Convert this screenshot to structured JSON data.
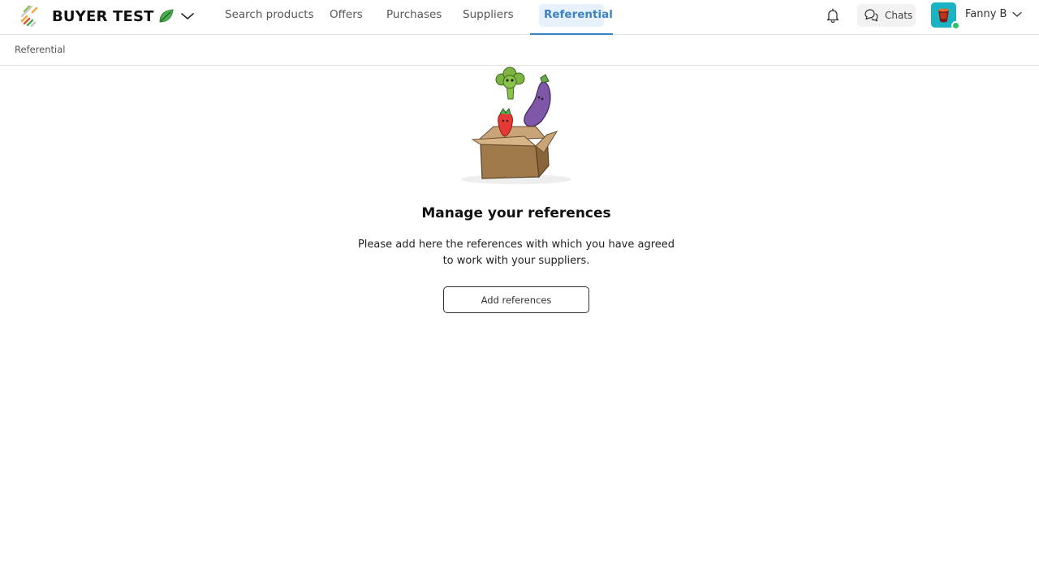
{
  "brand": {
    "name": "BUYER TEST"
  },
  "nav": {
    "items": [
      {
        "label": "Search products"
      },
      {
        "label": "Offers"
      },
      {
        "label": "Purchases"
      },
      {
        "label": "Suppliers"
      },
      {
        "label": "Referential",
        "active": true
      }
    ]
  },
  "header": {
    "chats_label": "Chats",
    "user_name": "Fanny B",
    "user_status": "online"
  },
  "breadcrumb": {
    "label": "Referential"
  },
  "empty_state": {
    "title": "Manage your references",
    "text": "Please add here the references with which you have agreed to work with your suppliers.",
    "button_label": "Add references"
  },
  "colors": {
    "accent": "#3b82c4",
    "accent_bg": "#e7f1fb",
    "online": "#2fc26b",
    "avatar_bg": "#19b3c4"
  },
  "icons": [
    "brand-logo-icon",
    "leaf-icon",
    "chevron-down-icon",
    "bell-icon",
    "chat-bubbles-icon",
    "user-avatar"
  ]
}
